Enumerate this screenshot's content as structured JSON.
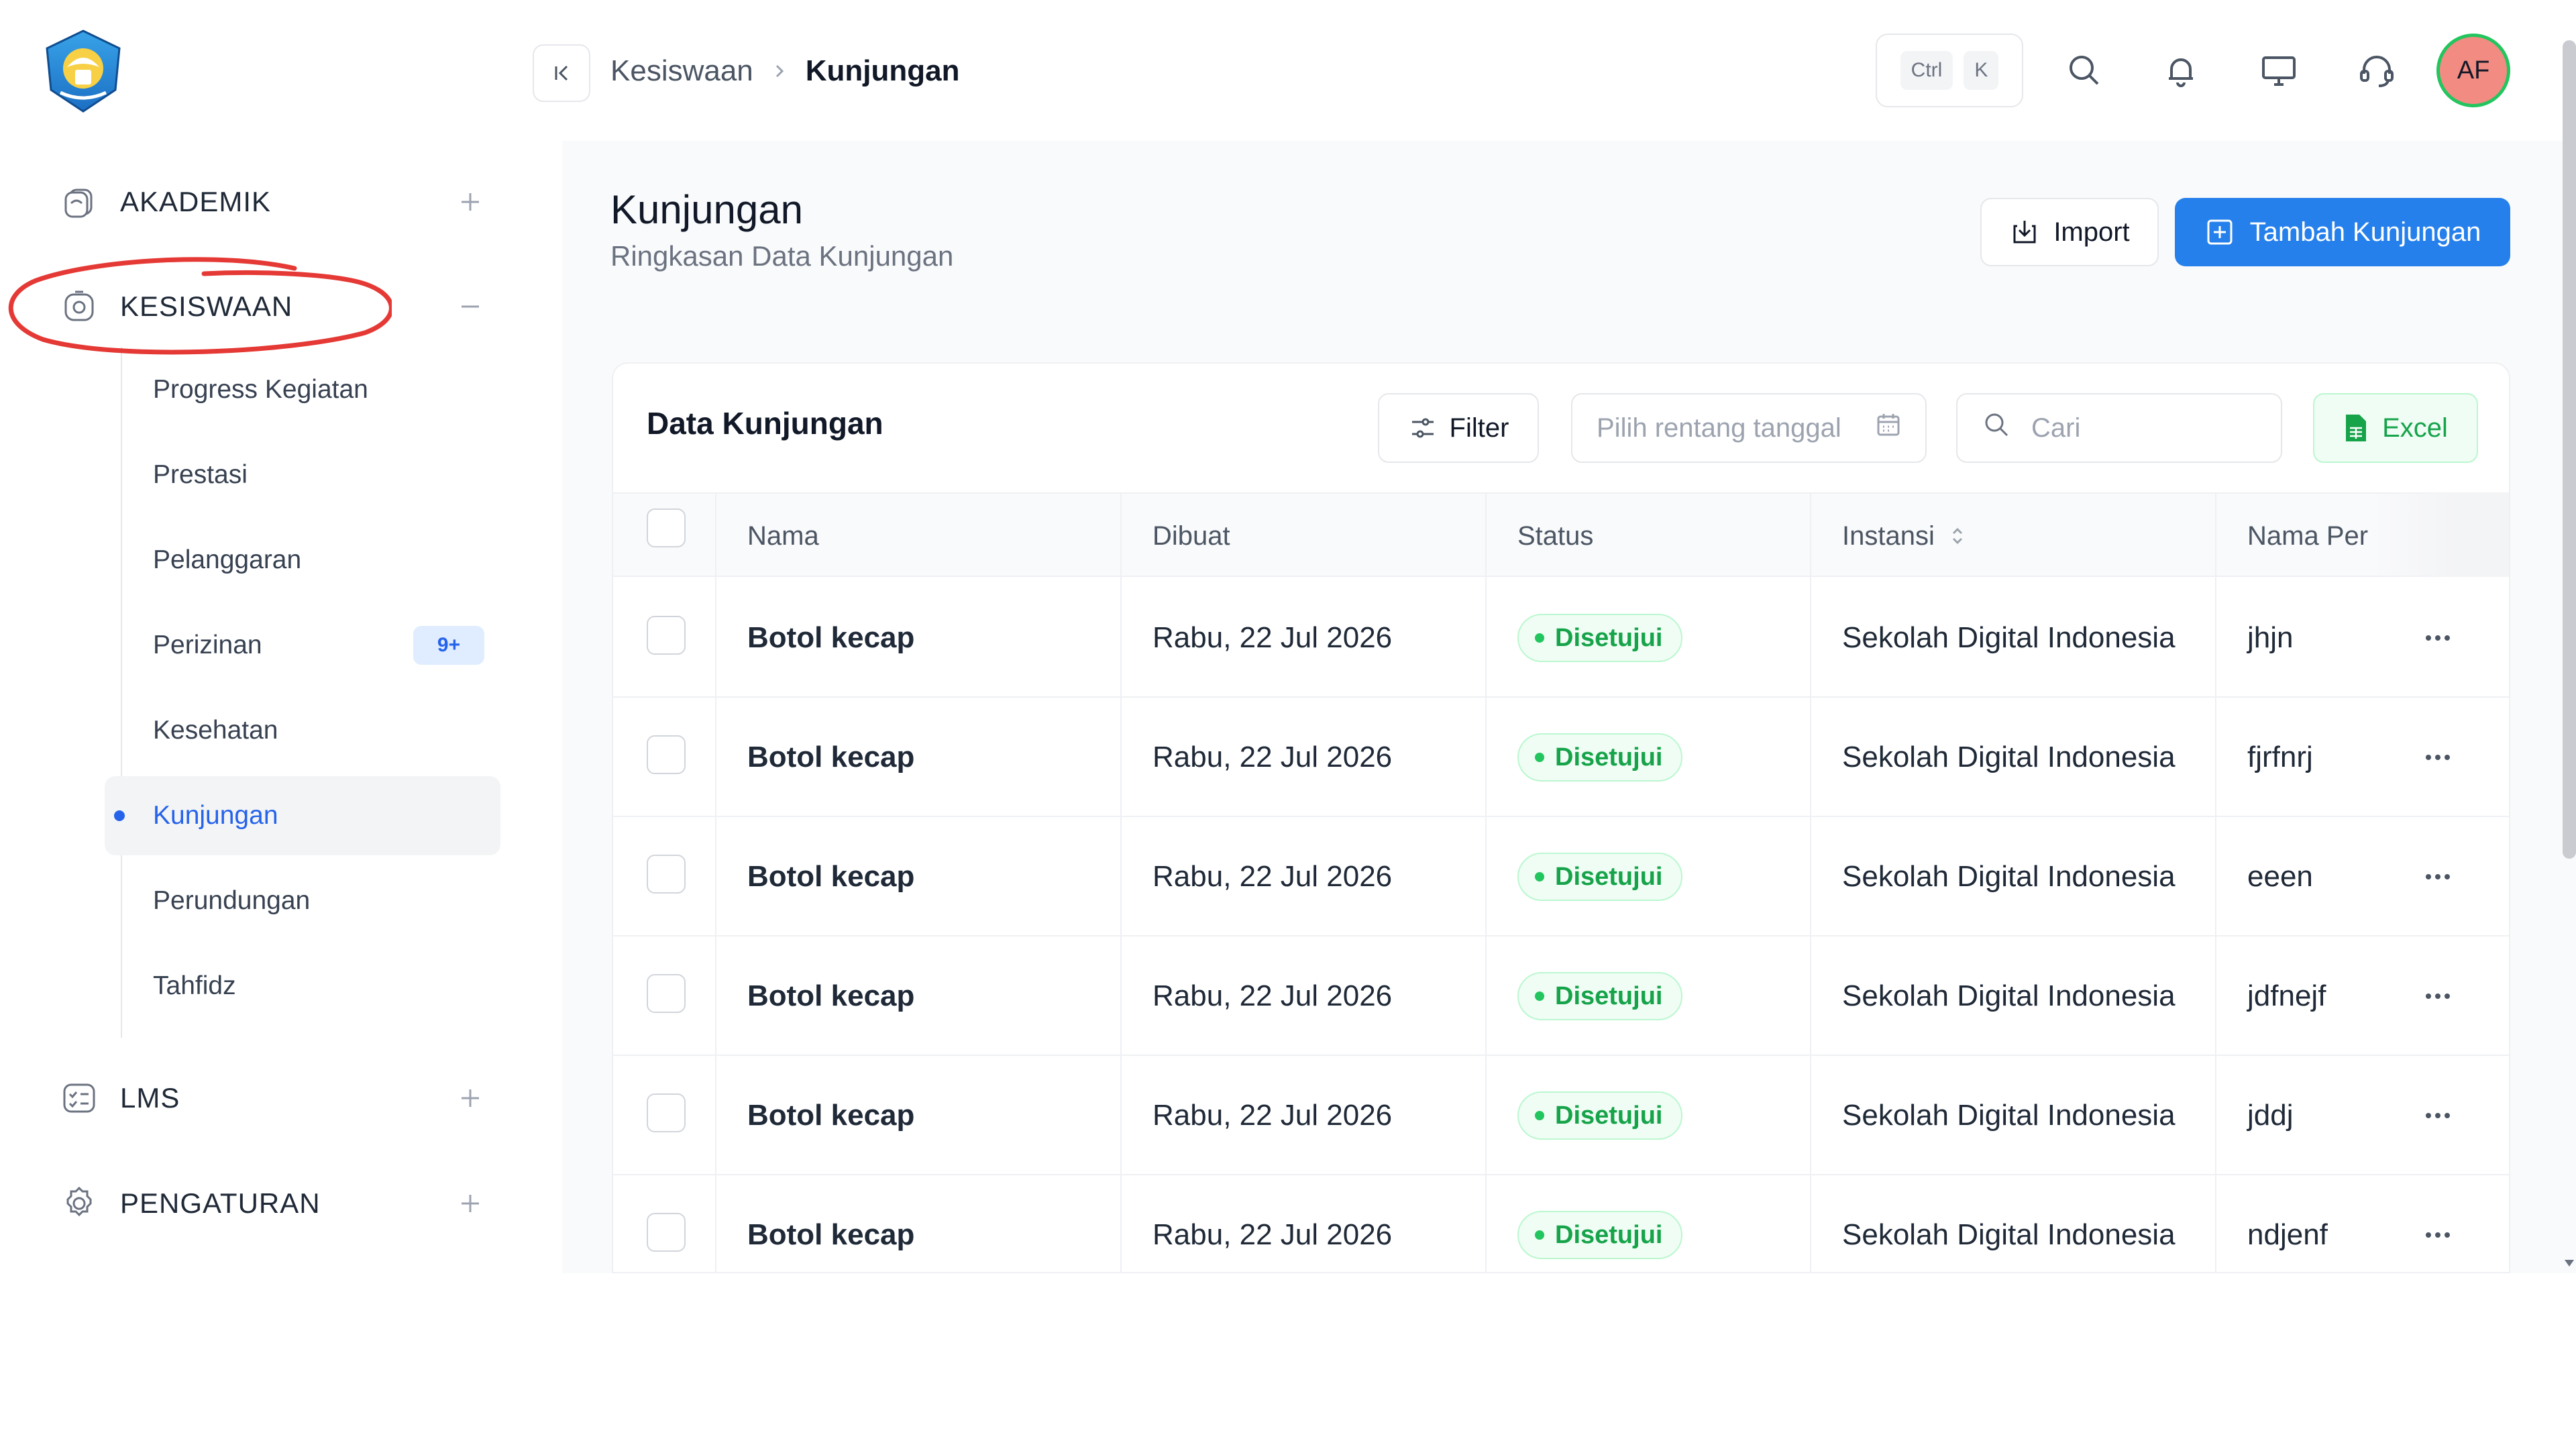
{
  "sidebar": {
    "groups": [
      {
        "label": "AKADEMIK",
        "icon": "layers-icon",
        "toggle": "plus-icon"
      },
      {
        "label": "KESISWAAN",
        "icon": "student-badge-icon",
        "toggle": "minus-icon"
      },
      {
        "label": "LMS",
        "icon": "checklist-icon",
        "toggle": "plus-icon"
      },
      {
        "label": "PENGATURAN",
        "icon": "gear-icon",
        "toggle": "plus-icon"
      }
    ],
    "kesiswaan_items": [
      {
        "label": "Progress Kegiatan"
      },
      {
        "label": "Prestasi"
      },
      {
        "label": "Pelanggaran"
      },
      {
        "label": "Perizinan",
        "badge": "9+"
      },
      {
        "label": "Kesehatan"
      },
      {
        "label": "Kunjungan",
        "active": true
      },
      {
        "label": "Perundungan"
      },
      {
        "label": "Tahfidz"
      }
    ]
  },
  "header": {
    "breadcrumb": {
      "parent": "Kesiswaan",
      "current": "Kunjungan"
    },
    "shortcut": {
      "key1": "Ctrl",
      "key2": "K"
    },
    "icons": [
      "search-icon",
      "bell-icon",
      "monitor-icon",
      "headset-icon"
    ],
    "avatar_initials": "AF"
  },
  "page": {
    "title": "Kunjungan",
    "subtitle": "Ringkasan Data Kunjungan",
    "import_label": "Import",
    "add_label": "Tambah Kunjungan"
  },
  "card": {
    "title": "Data Kunjungan",
    "filter_label": "Filter",
    "date_placeholder": "Pilih rentang tanggal",
    "search_placeholder": "Cari",
    "excel_label": "Excel"
  },
  "table": {
    "columns": [
      "Nama",
      "Dibuat",
      "Status",
      "Instansi",
      "Nama Per"
    ],
    "rows": [
      {
        "nama": "Botol kecap",
        "dibuat": "Rabu, 22 Jul 2026",
        "status": "Disetujui",
        "instansi": "Sekolah Digital Indonesia",
        "nama_per": "jhjn"
      },
      {
        "nama": "Botol kecap",
        "dibuat": "Rabu, 22 Jul 2026",
        "status": "Disetujui",
        "instansi": "Sekolah Digital Indonesia",
        "nama_per": "fjrfnrj"
      },
      {
        "nama": "Botol kecap",
        "dibuat": "Rabu, 22 Jul 2026",
        "status": "Disetujui",
        "instansi": "Sekolah Digital Indonesia",
        "nama_per": "eeen"
      },
      {
        "nama": "Botol kecap",
        "dibuat": "Rabu, 22 Jul 2026",
        "status": "Disetujui",
        "instansi": "Sekolah Digital Indonesia",
        "nama_per": "jdfnejf"
      },
      {
        "nama": "Botol kecap",
        "dibuat": "Rabu, 22 Jul 2026",
        "status": "Disetujui",
        "instansi": "Sekolah Digital Indonesia",
        "nama_per": "jddj"
      },
      {
        "nama": "Botol kecap",
        "dibuat": "Rabu, 22 Jul 2026",
        "status": "Disetujui",
        "instansi": "Sekolah Digital Indonesia",
        "nama_per": "ndjenf"
      }
    ]
  },
  "colors": {
    "primary": "#2680eb",
    "success": "#16a34a",
    "annotation": "#e53935",
    "avatar_bg": "#f28b82",
    "avatar_ring": "#22c55e"
  }
}
